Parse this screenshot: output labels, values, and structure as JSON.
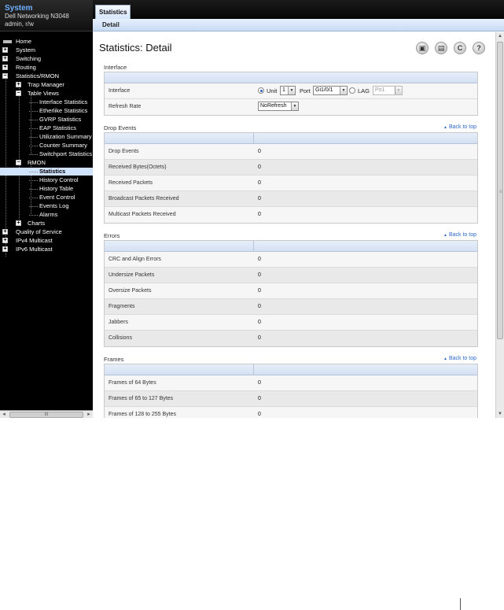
{
  "sidebar": {
    "system_title": "System",
    "device": "Dell Networking N3048",
    "user": "admin, r/w",
    "tree": [
      {
        "label": "Home",
        "expander": "",
        "icon": "home-icon"
      },
      {
        "label": "System",
        "expander": "+"
      },
      {
        "label": "Switching",
        "expander": "+"
      },
      {
        "label": "Routing",
        "expander": "+"
      },
      {
        "label": "Statistics/RMON",
        "expander": "−"
      },
      {
        "label": "Trap Manager",
        "expander": "+"
      },
      {
        "label": "Table Views",
        "expander": "−"
      },
      {
        "label": "Interface Statistics",
        "expander": ""
      },
      {
        "label": "Etherlike Statistics",
        "expander": ""
      },
      {
        "label": "GVRP Statistics",
        "expander": ""
      },
      {
        "label": "EAP Statistics",
        "expander": ""
      },
      {
        "label": "Utilization Summary",
        "expander": ""
      },
      {
        "label": "Counter Summary",
        "expander": ""
      },
      {
        "label": "Switchport Statistics",
        "expander": ""
      },
      {
        "label": "RMON",
        "expander": "−"
      },
      {
        "label": "Statistics",
        "expander": "",
        "selected": true
      },
      {
        "label": "History Control",
        "expander": ""
      },
      {
        "label": "History Table",
        "expander": ""
      },
      {
        "label": "Event Control",
        "expander": ""
      },
      {
        "label": "Events Log",
        "expander": ""
      },
      {
        "label": "Alarms",
        "expander": ""
      },
      {
        "label": "Charts",
        "expander": "+"
      },
      {
        "label": "Quality of Service",
        "expander": "+"
      },
      {
        "label": "IPv4 Multicast",
        "expander": "+"
      },
      {
        "label": "IPv6 Multicast",
        "expander": "+"
      }
    ],
    "hscroll_grip": "III",
    "hscroll_left": "◂",
    "hscroll_right": "▸"
  },
  "tabs": {
    "main_tab": "Statistics",
    "sub_tab": "Detail"
  },
  "page": {
    "title": "Statistics: Detail",
    "icons": [
      {
        "name": "save-icon",
        "glyph": "▣"
      },
      {
        "name": "print-icon",
        "glyph": "▤"
      },
      {
        "name": "refresh-icon",
        "glyph": "C"
      },
      {
        "name": "help-icon",
        "glyph": "?"
      }
    ],
    "back_to_top": "Back to top"
  },
  "interface_section": {
    "title": "Interface",
    "interface_label": "Interface",
    "unit_label": "Unit",
    "unit_value": "1",
    "port_label": "Port",
    "port_value": "Gi1/0/1",
    "lag_label": "LAG",
    "lag_value": "Po1",
    "refresh_label": "Refresh Rate",
    "refresh_value": "NoRefresh"
  },
  "drop_events": {
    "title": "Drop Events",
    "rows": [
      {
        "label": "Drop Events",
        "value": "0"
      },
      {
        "label": "Received Bytes(Octets)",
        "value": "0"
      },
      {
        "label": "Received Packets",
        "value": "0"
      },
      {
        "label": "Broadcast Packets Received",
        "value": "0"
      },
      {
        "label": "Multicast Packets Received",
        "value": "0"
      }
    ]
  },
  "errors": {
    "title": "Errors",
    "rows": [
      {
        "label": "CRC and Align Errors",
        "value": "0"
      },
      {
        "label": "Undersize Packets",
        "value": "0"
      },
      {
        "label": "Oversize Packets",
        "value": "0"
      },
      {
        "label": "Fragments",
        "value": "0"
      },
      {
        "label": "Jabbers",
        "value": "0"
      },
      {
        "label": "Collisions",
        "value": "0"
      }
    ]
  },
  "frames": {
    "title": "Frames",
    "rows": [
      {
        "label": "Frames of 64 Bytes",
        "value": "0"
      },
      {
        "label": "Frames of 65 to 127 Bytes",
        "value": "0"
      },
      {
        "label": "Frames of 128 to 255 Bytes",
        "value": "0"
      }
    ]
  }
}
